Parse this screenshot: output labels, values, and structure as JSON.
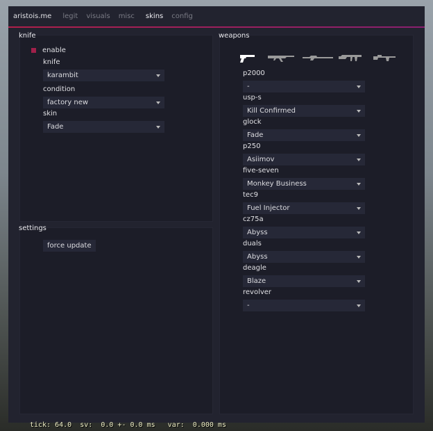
{
  "title": "aristois.me",
  "tabs": [
    {
      "label": "legit"
    },
    {
      "label": "visuals"
    },
    {
      "label": "misc"
    },
    {
      "label": "skins"
    },
    {
      "label": "config"
    }
  ],
  "accent_color": "#b0204a",
  "knife_panel": {
    "title": "knife",
    "enable_label": "enable",
    "enable_checked": true,
    "knife_label": "knife",
    "knife_value": "karambit",
    "condition_label": "condition",
    "condition_value": "factory new",
    "skin_label": "skin",
    "skin_value": "Fade"
  },
  "settings_panel": {
    "title": "settings",
    "force_update_label": "force update"
  },
  "weapons_panel": {
    "title": "weapons",
    "categories": [
      {
        "icon": "pistol-icon"
      },
      {
        "icon": "rifle-icon"
      },
      {
        "icon": "sniper-icon"
      },
      {
        "icon": "smg-icon"
      },
      {
        "icon": "heavy-icon"
      }
    ],
    "weapons": [
      {
        "name": "p2000",
        "skin": "-"
      },
      {
        "name": "usp-s",
        "skin": "Kill Confirmed"
      },
      {
        "name": "glock",
        "skin": "Fade"
      },
      {
        "name": "p250",
        "skin": "Asiimov"
      },
      {
        "name": "five-seven",
        "skin": "Monkey Business"
      },
      {
        "name": "tec9",
        "skin": "Fuel Injector"
      },
      {
        "name": "cz75a",
        "skin": "Abyss"
      },
      {
        "name": "duals",
        "skin": "Abyss"
      },
      {
        "name": "deagle",
        "skin": "Blaze"
      },
      {
        "name": "revolver",
        "skin": "-"
      }
    ]
  },
  "footer": "tick: 64.0  sv:  0.0 +- 0.0 ms   var:  0.000 ms"
}
